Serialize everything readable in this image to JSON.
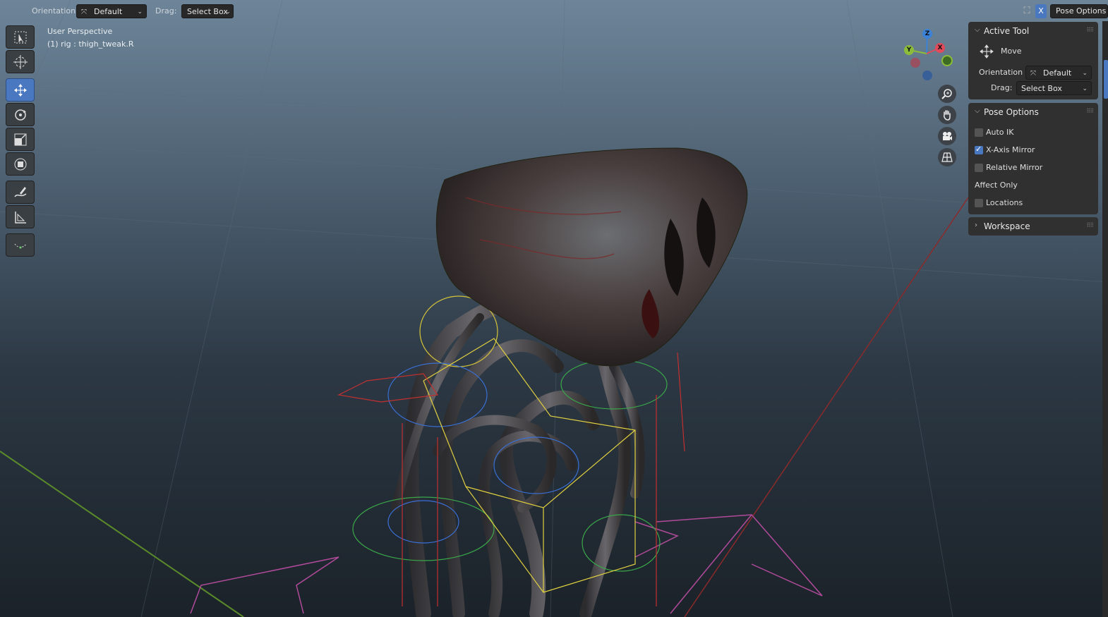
{
  "header": {
    "orientation_label": "Orientation:",
    "orientation_value": "Default",
    "drag_label": "Drag:",
    "drag_value": "Select Box",
    "xmirror_toggle": "X",
    "pose_options_button": "Pose Options"
  },
  "overlay": {
    "view_name": "User Perspective",
    "active_object": "(1) rig : thigh_tweak.R"
  },
  "toolbar": {
    "tools": [
      {
        "name": "select-box-tool",
        "icon": "select-box-icon",
        "active": false
      },
      {
        "name": "cursor-tool",
        "icon": "cursor-icon",
        "active": false
      },
      {
        "name": "move-tool",
        "icon": "move-icon",
        "active": true
      },
      {
        "name": "rotate-tool",
        "icon": "rotate-icon",
        "active": false
      },
      {
        "name": "scale-tool",
        "icon": "scale-icon",
        "active": false
      },
      {
        "name": "transform-tool",
        "icon": "transform-icon",
        "active": false
      },
      {
        "name": "annotate-tool",
        "icon": "annotate-icon",
        "active": false
      },
      {
        "name": "measure-tool",
        "icon": "measure-icon",
        "active": false
      },
      {
        "name": "bone-tool",
        "icon": "bone-path-icon",
        "active": false
      }
    ]
  },
  "gizmo": {
    "z": "Z",
    "y": "Y",
    "x": "X",
    "colors": {
      "x": "#e04a5a",
      "y": "#8bbd3a",
      "z": "#3b82d6"
    }
  },
  "navigation": [
    "zoom-icon",
    "pan-hand-icon",
    "camera-icon",
    "grid-perspective-icon"
  ],
  "sidebar": {
    "active_tool": {
      "title": "Active Tool",
      "tool_name": "Move",
      "orientation_label": "Orientation",
      "orientation_value": "Default",
      "drag_label": "Drag:",
      "drag_value": "Select Box"
    },
    "pose_options": {
      "title": "Pose Options",
      "auto_ik": {
        "label": "Auto IK",
        "checked": false
      },
      "x_axis_mirror": {
        "label": "X-Axis Mirror",
        "checked": true
      },
      "relative_mirror": {
        "label": "Relative Mirror",
        "checked": false
      },
      "affect_only_label": "Affect Only",
      "locations": {
        "label": "Locations",
        "checked": false
      }
    },
    "workspace": {
      "title": "Workspace"
    }
  },
  "colors": {
    "accent": "#4a78c0",
    "panel_bg": "#303030"
  }
}
